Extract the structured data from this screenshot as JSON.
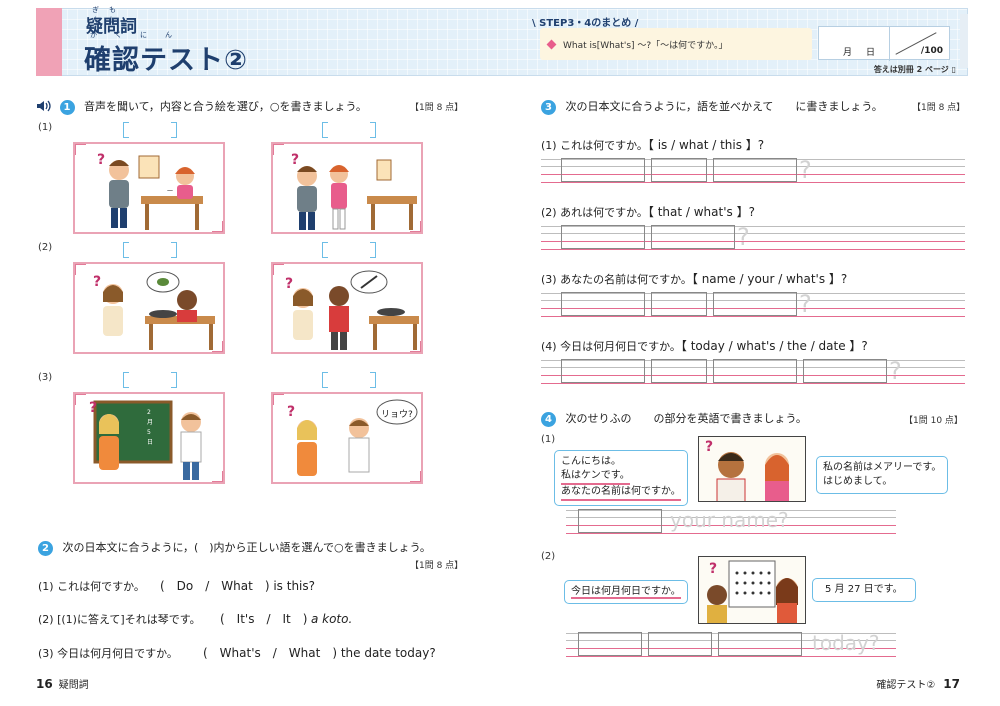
{
  "header": {
    "small_title": "疑問詞",
    "small_title_ruby": "ぎもんし",
    "title": "確認テスト②",
    "title_ruby": "かくにん",
    "step": "STEP3・4のまとめ",
    "summary": "What is[What's] ～?「～は何ですか。」",
    "month": "月",
    "day": "日",
    "total": "100",
    "answers_note": "答えは別冊 2 ページ"
  },
  "q1": {
    "num": "1",
    "text": "音声を聞いて，内容と合う絵を選び，○を書きましょう。",
    "points": "【1問 8 点】",
    "items": [
      {
        "label": "(1)"
      },
      {
        "label": "(2)"
      },
      {
        "label": "(3)"
      }
    ],
    "bubble_ryo": "リョウ?"
  },
  "q2": {
    "num": "2",
    "text": "次の日本文に合うように，(　)内から正しい語を選んで○を書きましょう。",
    "points": "【1問 8 点】",
    "items": [
      {
        "label": "(1)",
        "ja": "これは何ですか。",
        "choice": "(　Do　/　What　) is this?"
      },
      {
        "label": "(2)",
        "ja": "[(1)に答えて]それは琴です。",
        "choice": "(　It's　/　It　)",
        "tail": "a koto."
      },
      {
        "label": "(3)",
        "ja": "今日は何月何日ですか。",
        "choice": "(　What's　/　What　) the date today?"
      }
    ]
  },
  "q3": {
    "num": "3",
    "text": "次の日本文に合うように，語を並べかえて　　に書きましょう。",
    "points": "【1問 8 点】",
    "items": [
      {
        "label": "(1)",
        "ja": "これは何ですか。",
        "words": "【 is / what / this 】?"
      },
      {
        "label": "(2)",
        "ja": "あれは何ですか。",
        "words": "【 that / what's 】?"
      },
      {
        "label": "(3)",
        "ja": "あなたの名前は何ですか。",
        "words": "【 name / your / what's 】?"
      },
      {
        "label": "(4)",
        "ja": "今日は何月何日ですか。",
        "words": "【 today / what's / the / date 】?"
      }
    ]
  },
  "q4": {
    "num": "4",
    "text": "次のせりふの　　の部分を英語で書きましょう。",
    "points": "【1問 10 点】",
    "item1": {
      "label": "(1)",
      "left_lines": [
        "こんにちは。",
        "私はケンです。",
        "あなたの名前は何ですか。"
      ],
      "right_lines": [
        "私の名前はメアリーです。",
        "はじめまして。"
      ],
      "ghost": "your name?"
    },
    "item2": {
      "label": "(2)",
      "left": "今日は何月何日ですか。",
      "right": "5 月 27 日です。",
      "ghost": "today?"
    }
  },
  "footer": {
    "left_page": "16",
    "left_title": "疑問詞",
    "right_title": "確認テスト②",
    "right_page": "17"
  },
  "colors": {
    "accent_blue": "#3ba3e0",
    "pink": "#e46b8f",
    "navy": "#1f3f6e"
  }
}
